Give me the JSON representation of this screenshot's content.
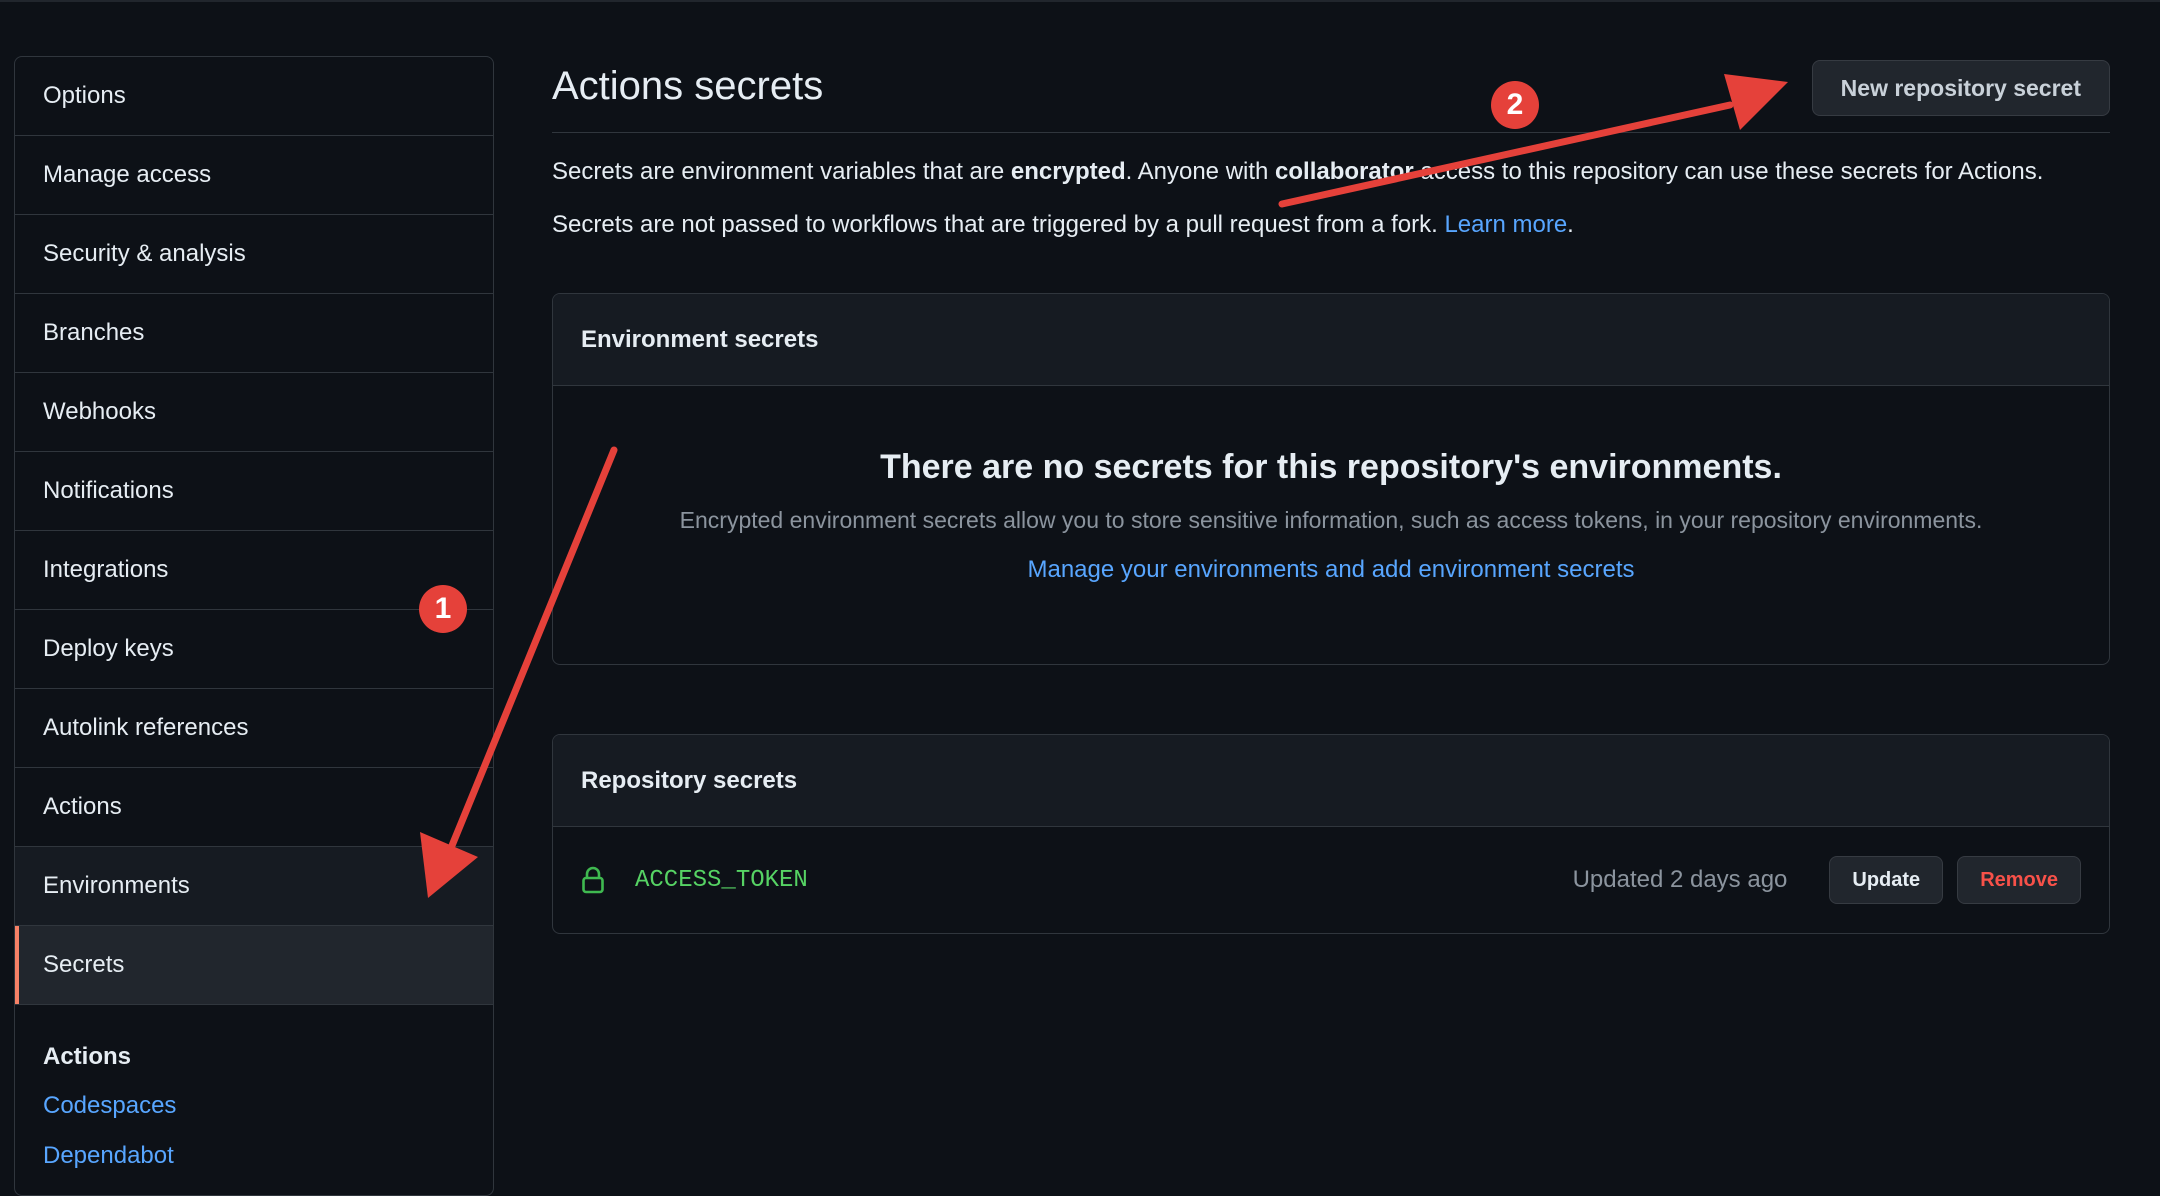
{
  "sidebar": {
    "items": [
      {
        "label": "Options"
      },
      {
        "label": "Manage access"
      },
      {
        "label": "Security & analysis"
      },
      {
        "label": "Branches"
      },
      {
        "label": "Webhooks"
      },
      {
        "label": "Notifications"
      },
      {
        "label": "Integrations"
      },
      {
        "label": "Deploy keys"
      },
      {
        "label": "Autolink references"
      },
      {
        "label": "Actions"
      },
      {
        "label": "Environments"
      },
      {
        "label": "Secrets"
      }
    ],
    "active_item": "Secrets",
    "subheading": "Actions",
    "sub_links": [
      {
        "label": "Codespaces"
      },
      {
        "label": "Dependabot"
      }
    ]
  },
  "main": {
    "title": "Actions secrets",
    "new_secret_button": "New repository secret",
    "desc1_a": "Secrets are environment variables that are ",
    "desc1_b": "encrypted",
    "desc1_c": ". Anyone with ",
    "desc1_d": "collaborator",
    "desc1_e": " access to this repository can use these secrets for Actions.",
    "desc2": "Secrets are not passed to workflows that are triggered by a pull request from a fork. ",
    "learn_more": "Learn more",
    "desc2_end": "."
  },
  "environment_secrets": {
    "heading": "Environment secrets",
    "empty_title": "There are no secrets for this repository's environments.",
    "empty_desc": "Encrypted environment secrets allow you to store sensitive information, such as access tokens, in your repository environments.",
    "manage_link": "Manage your environments and add environment secrets"
  },
  "repository_secrets": {
    "heading": "Repository secrets",
    "rows": [
      {
        "name": "ACCESS_TOKEN",
        "updated": "Updated 2 days ago",
        "update_label": "Update",
        "remove_label": "Remove",
        "icon": "lock-icon"
      }
    ]
  },
  "annotations": {
    "badge1": "1",
    "badge2": "2",
    "color": "#e5413a"
  }
}
